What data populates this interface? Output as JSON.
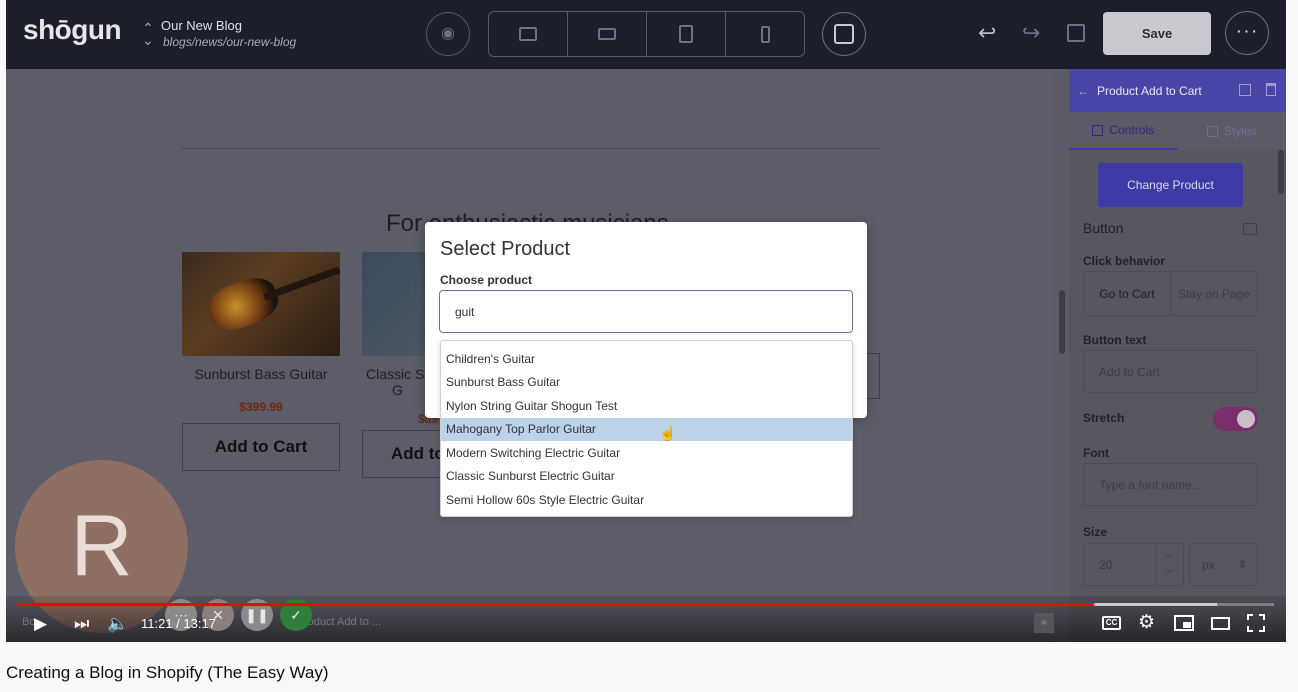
{
  "app": {
    "logo": "shōgun",
    "page_title": "Our New Blog",
    "page_path": "blogs/news/our-new-blog",
    "save_label": "Save",
    "more_label": "···"
  },
  "canvas": {
    "section_heading": "For enthusiastic musicians",
    "products": [
      {
        "name": "Sunburst Bass Guitar",
        "price": "$399.99",
        "button": "Add to Cart"
      },
      {
        "name": "Classic Su",
        "name2": "G",
        "price": "$89",
        "button": "Add to"
      }
    ]
  },
  "modal": {
    "title": "Select Product",
    "label": "Choose product",
    "search_value": "guit",
    "options": [
      "Children's Guitar",
      "Sunburst Bass Guitar",
      "Nylon String Guitar Shogun Test",
      "Mahogany Top Parlor Guitar",
      "Modern Switching Electric Guitar",
      "Classic Sunburst Electric Guitar",
      "Semi Hollow 60s Style Electric Guitar"
    ],
    "highlighted_index": 3
  },
  "panel": {
    "title": "Product Add to Cart",
    "tabs": [
      "Controls",
      "Styles"
    ],
    "change_product": "Change Product",
    "section": "Button",
    "click_behavior_label": "Click behavior",
    "click_options": [
      "Go to Cart",
      "Stay on Page"
    ],
    "button_text_label": "Button text",
    "button_text_value": "Add to Cart",
    "stretch_label": "Stretch",
    "font_label": "Font",
    "font_placeholder": "Type a font name...",
    "size_label": "Size",
    "size_value": "20",
    "size_unit": "px"
  },
  "player": {
    "avatar_letter": "R",
    "time": "11:21 / 13:17",
    "progress_fraction": 0.856,
    "breadcrumb_ghost_left": "Bo",
    "breadcrumb_ghost_right": "roduct Add to ...",
    "cc_label": "CC"
  },
  "video_title": "Creating a Blog in Shopify (The Easy Way)",
  "colors": {
    "topbar": "#1c1e2b",
    "panel_accent": "#4a46a8",
    "toggle_on": "#7a2e6c",
    "progress": "#ff0000",
    "highlight": "#bcd2e8"
  }
}
